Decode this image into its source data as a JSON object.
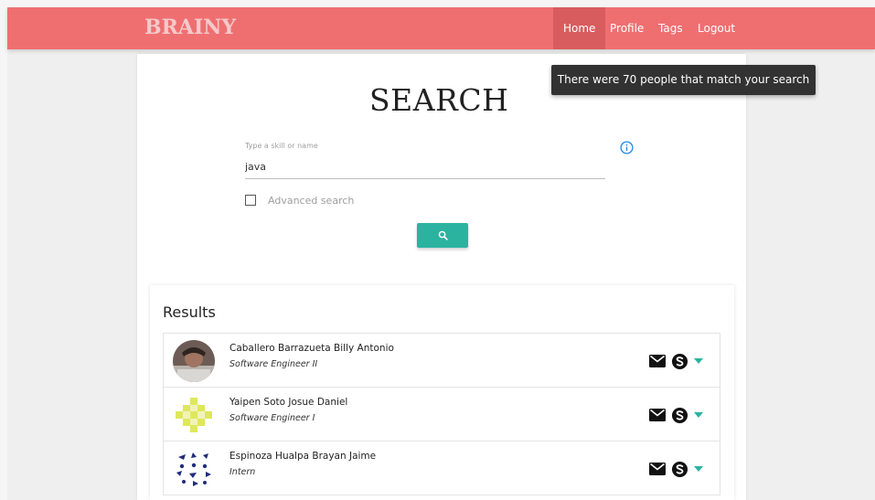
{
  "navbar": {
    "brand": "BRAINY",
    "items": [
      {
        "label": "Home",
        "active": true
      },
      {
        "label": "Profile"
      },
      {
        "label": "Tags"
      },
      {
        "label": "Logout"
      }
    ]
  },
  "toast": "There were 70 people that match your search",
  "search": {
    "title": "SEARCH",
    "field_label": "Type a skill or name",
    "value": "java",
    "advanced_label": "Advanced search",
    "advanced_checked": false
  },
  "results": {
    "title": "Results",
    "items": [
      {
        "name": "Caballero Barrazueta Billy Antonio",
        "role": "Software Engineer II"
      },
      {
        "name": "Yaipen Soto Josue Daniel",
        "role": "Software Engineer I"
      },
      {
        "name": "Espinoza Hualpa Brayan Jaime",
        "role": "Intern"
      }
    ]
  },
  "colors": {
    "navbar": "#ef6f71",
    "nav_active": "#d85c5e",
    "accent": "#2bb3a0",
    "info": "#1e88e5"
  }
}
